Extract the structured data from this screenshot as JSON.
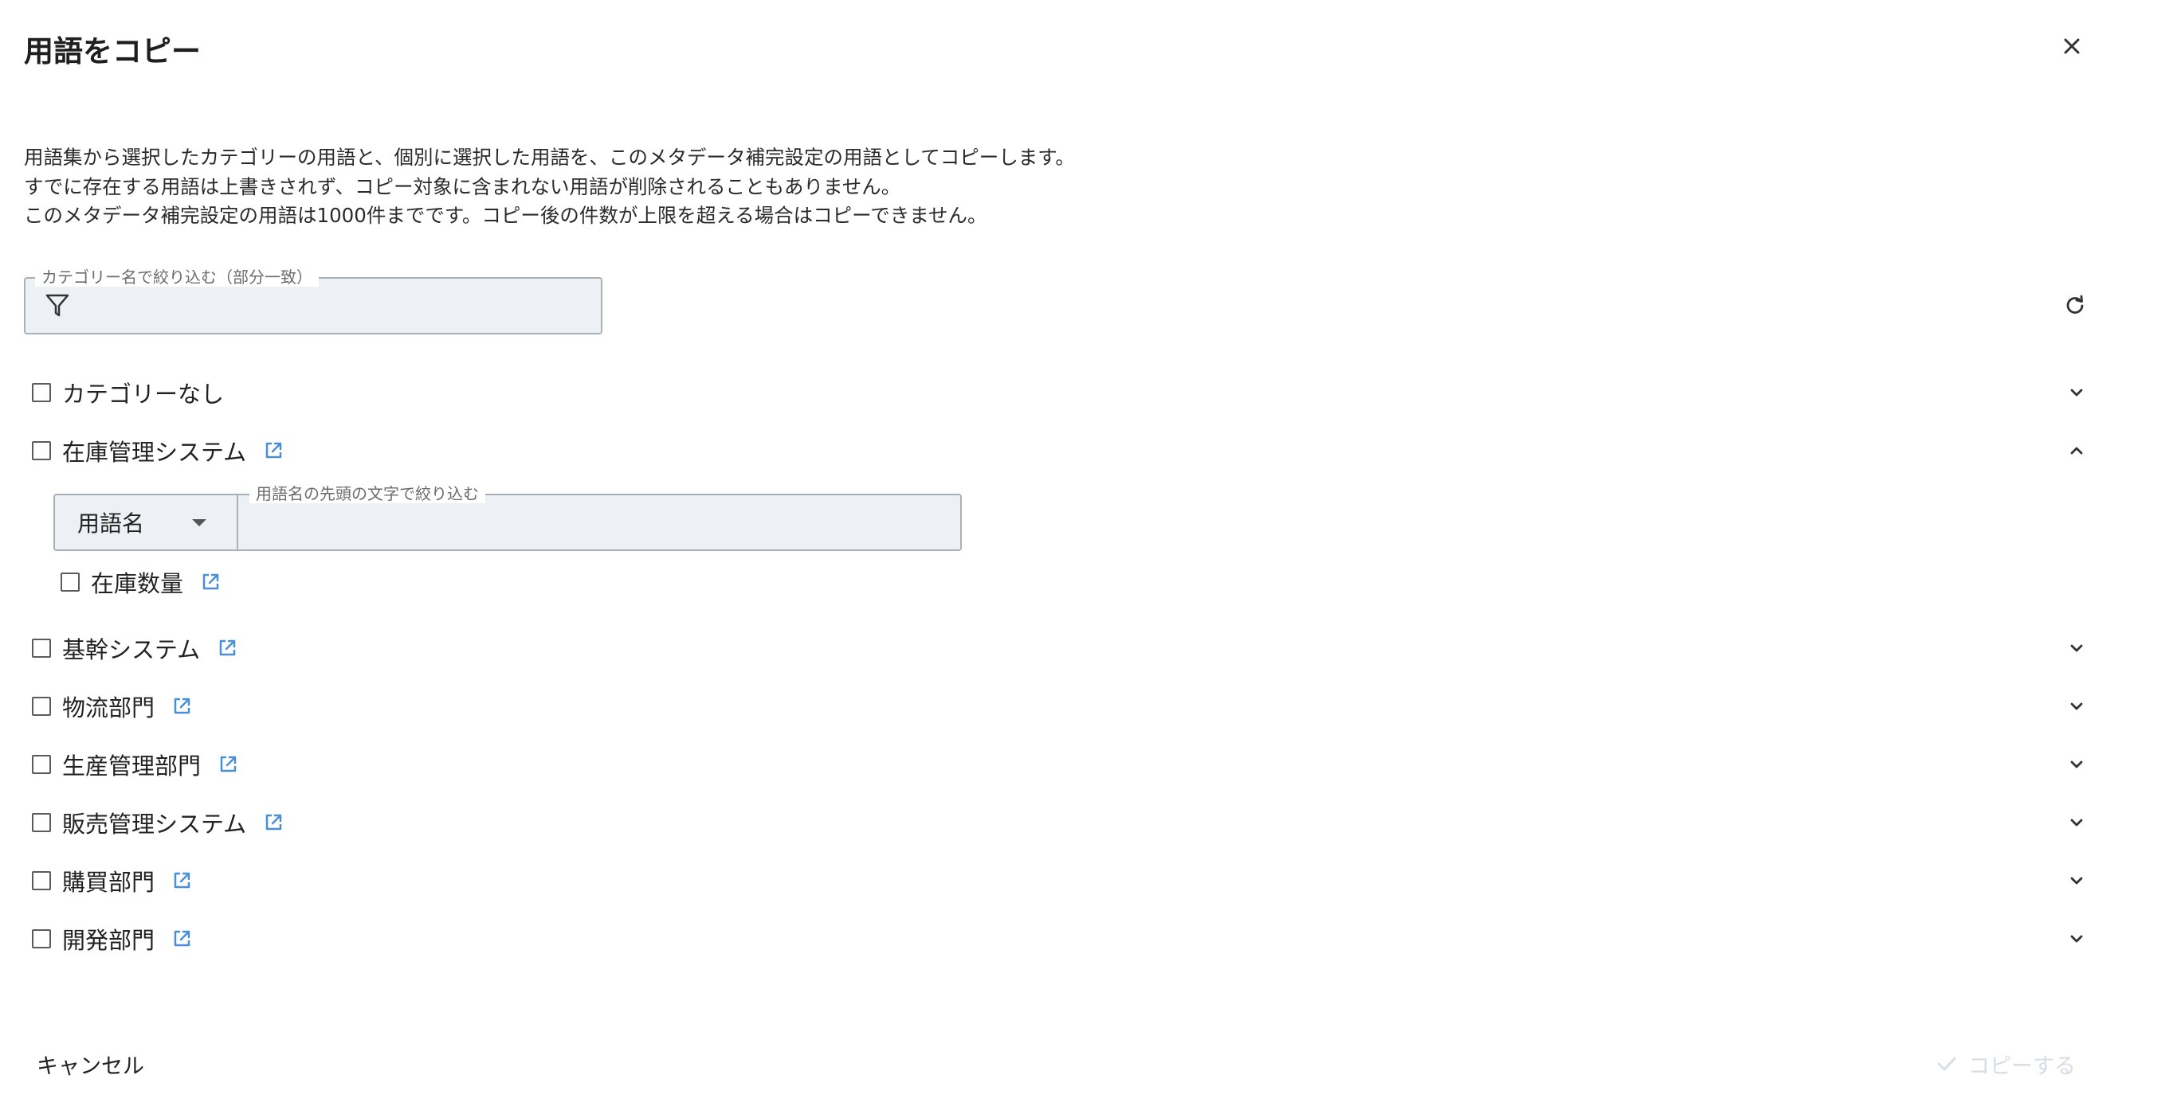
{
  "dialog": {
    "title": "用語をコピー",
    "description": [
      "用語集から選択したカテゴリーの用語と、個別に選択した用語を、このメタデータ補完設定の用語としてコピーします。",
      "すでに存在する用語は上書きされず、コピー対象に含まれない用語が削除されることもありません。",
      "このメタデータ補完設定の用語は1000件までです。コピー後の件数が上限を超える場合はコピーできません。"
    ]
  },
  "category_filter": {
    "label": "カテゴリー名で絞り込む（部分一致）",
    "value": ""
  },
  "categories": [
    {
      "label": "カテゴリーなし",
      "checked": false,
      "has_link": false,
      "expanded": false
    },
    {
      "label": "在庫管理システム",
      "checked": false,
      "has_link": true,
      "expanded": true
    },
    {
      "label": "基幹システム",
      "checked": false,
      "has_link": true,
      "expanded": false
    },
    {
      "label": "物流部門",
      "checked": false,
      "has_link": true,
      "expanded": false
    },
    {
      "label": "生産管理部門",
      "checked": false,
      "has_link": true,
      "expanded": false
    },
    {
      "label": "販売管理システム",
      "checked": false,
      "has_link": true,
      "expanded": false
    },
    {
      "label": "購買部門",
      "checked": false,
      "has_link": true,
      "expanded": false
    },
    {
      "label": "開発部門",
      "checked": false,
      "has_link": true,
      "expanded": false
    }
  ],
  "term_filter": {
    "select_value": "用語名",
    "label": "用語名の先頭の文字で絞り込む",
    "value": ""
  },
  "terms": [
    {
      "label": "在庫数量",
      "checked": false,
      "has_link": true
    }
  ],
  "footer": {
    "cancel_label": "キャンセル",
    "copy_label": "コピーする",
    "copy_enabled": false
  },
  "colors": {
    "link_icon": "#4a8fd6",
    "field_background": "#edf1f5",
    "disabled_text": "#d6dde5"
  },
  "icons": {
    "close": "close-icon",
    "filter": "filter-icon",
    "refresh": "refresh-icon",
    "expand": "chevron-down-icon",
    "collapse": "chevron-up-icon",
    "external_link": "external-link-icon",
    "check": "check-icon"
  }
}
